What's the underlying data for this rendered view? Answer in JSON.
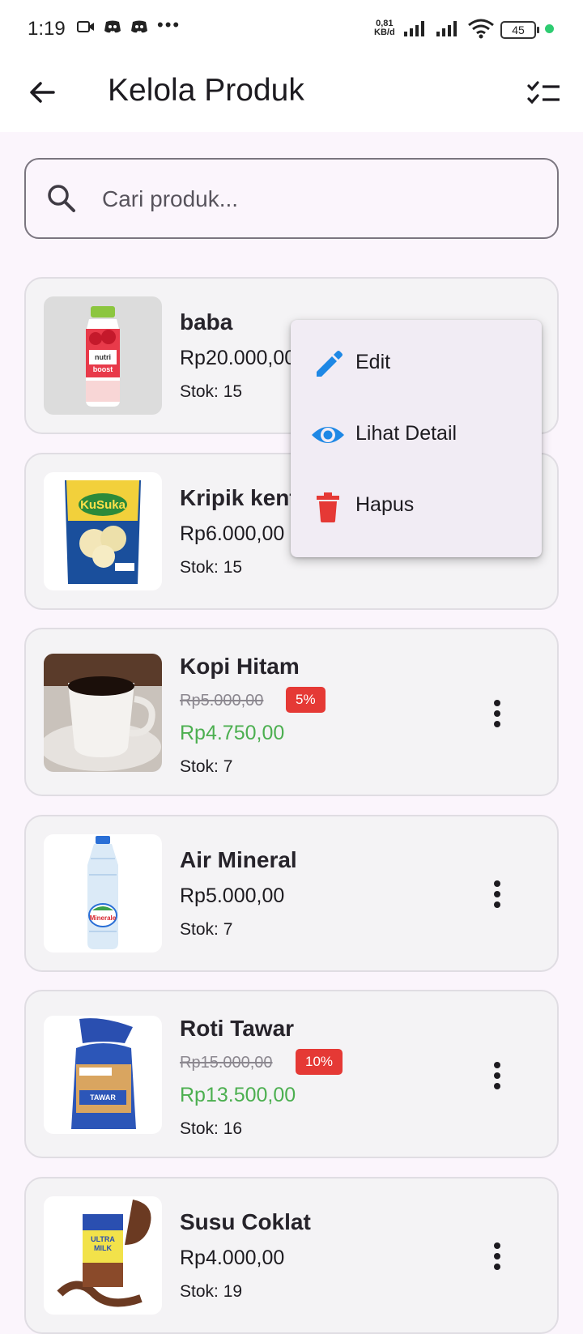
{
  "status_bar": {
    "time": "1:19",
    "net_speed_value": "0,81",
    "net_speed_unit": "KB/d",
    "battery": "45"
  },
  "app_bar": {
    "title": "Kelola Produk",
    "back_icon": "arrow-left-icon",
    "action_icon": "checklist-icon"
  },
  "search": {
    "placeholder": "Cari produk...",
    "value": ""
  },
  "products": [
    {
      "name": "baba",
      "price": "Rp20.000,00",
      "stock": "Stok: 15"
    },
    {
      "name": "Kripik kentang",
      "price": "Rp6.000,00",
      "stock": "Stok: 15"
    },
    {
      "name": "Kopi Hitam",
      "original_price": "Rp5.000,00",
      "discount_badge": "5%",
      "price": "Rp4.750,00",
      "stock": "Stok: 7"
    },
    {
      "name": "Air Mineral",
      "price": "Rp5.000,00",
      "stock": "Stok: 7"
    },
    {
      "name": "Roti Tawar",
      "original_price": "Rp15.000,00",
      "discount_badge": "10%",
      "price": "Rp13.500,00",
      "stock": "Stok: 16"
    },
    {
      "name": "Susu Coklat",
      "price": "Rp4.000,00",
      "stock": "Stok: 19"
    }
  ],
  "popup_menu": {
    "items": [
      {
        "label": "Edit",
        "icon": "pencil-icon",
        "color": "#1e88e5"
      },
      {
        "label": "Lihat Detail",
        "icon": "eye-icon",
        "color": "#1e88e5"
      },
      {
        "label": "Hapus",
        "icon": "trash-icon",
        "color": "#e53935"
      }
    ]
  },
  "colors": {
    "discount_price": "#4caf50",
    "badge": "#e53935",
    "background": "#fbf5fc"
  }
}
